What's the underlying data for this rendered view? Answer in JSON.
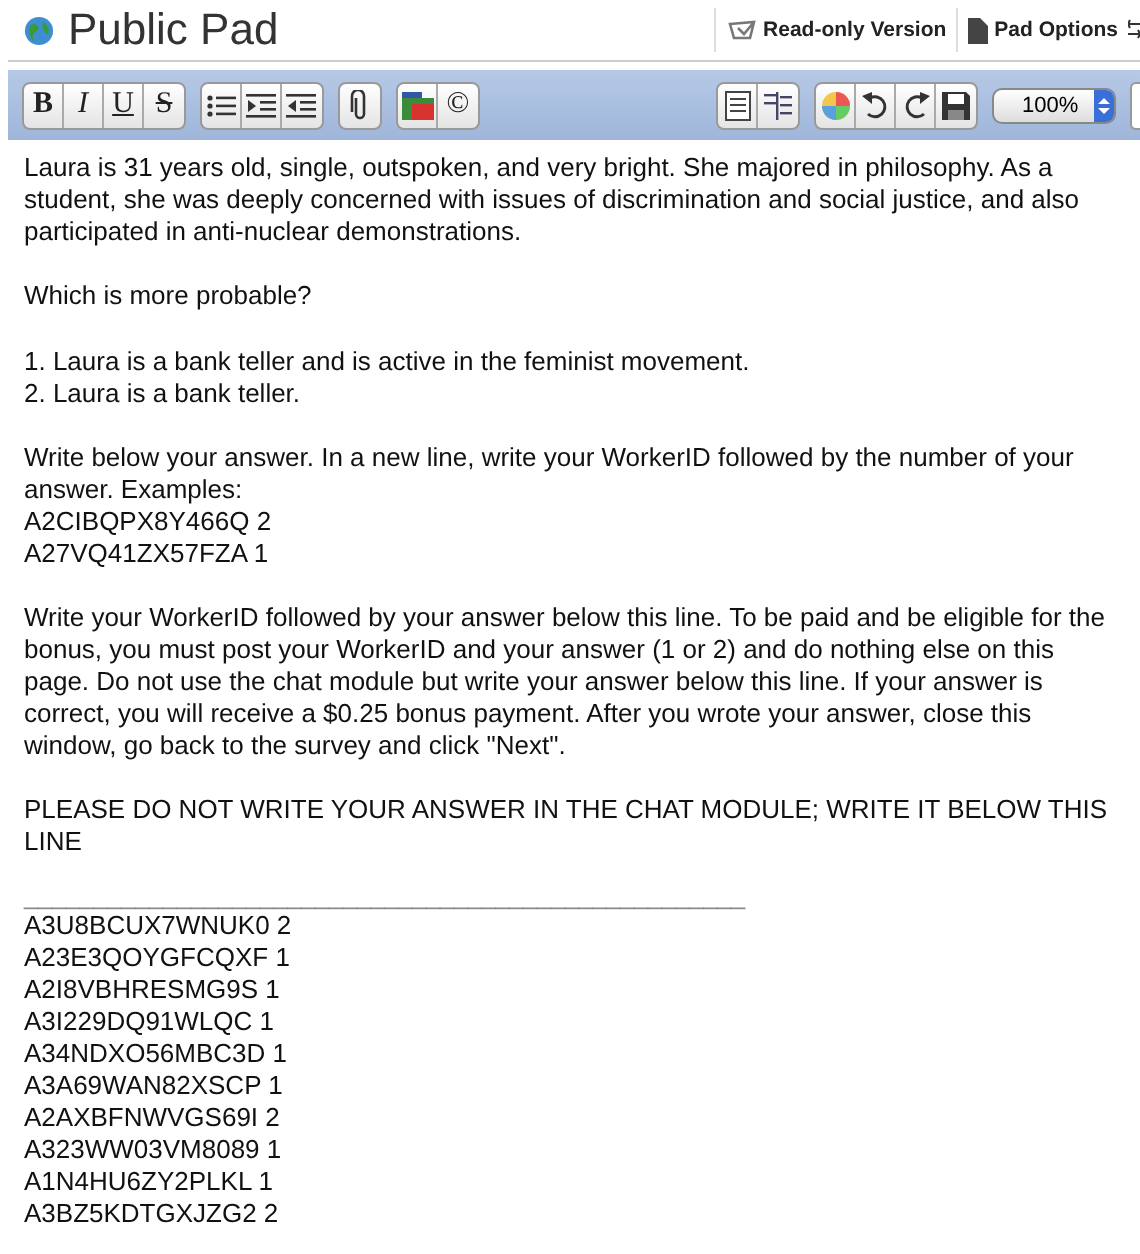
{
  "header": {
    "title": "Public Pad",
    "links": [
      {
        "label": "Read-only Version",
        "kind": "readonly"
      },
      {
        "label": "Pad Options",
        "kind": "options"
      }
    ]
  },
  "toolbar": {
    "left": [
      {
        "buttons": [
          {
            "kind": "bold",
            "label": "B"
          },
          {
            "kind": "italic",
            "label": "I"
          },
          {
            "kind": "underline",
            "label": "U"
          },
          {
            "kind": "strike",
            "label": "S"
          }
        ]
      },
      {
        "buttons": [
          {
            "kind": "bullets"
          },
          {
            "kind": "indent"
          },
          {
            "kind": "outdent"
          }
        ]
      },
      {
        "buttons": [
          {
            "kind": "attach"
          }
        ]
      },
      {
        "buttons": [
          {
            "kind": "flag"
          },
          {
            "kind": "copyright",
            "label": "©"
          }
        ]
      }
    ],
    "right": [
      {
        "buttons": [
          {
            "kind": "doc"
          },
          {
            "kind": "doclines"
          }
        ]
      },
      {
        "buttons": [
          {
            "kind": "colors"
          },
          {
            "kind": "undo"
          },
          {
            "kind": "redo"
          },
          {
            "kind": "save"
          }
        ]
      }
    ],
    "zoom": "100%"
  },
  "document": {
    "blocks": [
      {
        "lines": [
          "Laura is 31 years old, single, outspoken, and very bright. She majored in philosophy. As a student, she was deeply concerned with issues of discrimination and  social justice, and also participated in anti-nuclear demonstrations."
        ]
      },
      {
        "lines": [
          "Which is more probable?"
        ]
      },
      {
        "lines": [
          "1. Laura is a bank teller and is active in the feminist movement.",
          "2. Laura is a bank teller."
        ]
      },
      {
        "lines": [
          "Write below your answer. In a new line, write your WorkerID followed by the number of your answer. Examples:",
          "A2CIBQPX8Y466Q 2",
          "A27VQ41ZX57FZA 1"
        ]
      },
      {
        "lines": [
          "Write your WorkerID followed by your answer below this line. To be paid and be eligible for the bonus, you must post your WorkerID and your answer (1 or 2) and do nothing else on this page. Do not use the chat module but write your answer below this line. If your answer is correct, you will receive a $0.25 bonus payment. After you wrote your answer, close this window, go back to the survey and click \"Next\"."
        ]
      },
      {
        "lines": [
          "PLEASE DO NOT WRITE YOUR ANSWER IN THE CHAT MODULE; WRITE IT BELOW THIS LINE"
        ]
      },
      {
        "kind": "rule",
        "lines": [
          "____________________________________________________"
        ]
      },
      {
        "lines": [
          "A3U8BCUX7WNUK0 2",
          "A23E3QOYGFCQXF 1",
          "A2I8VBHRESMG9S 1",
          "A3I229DQ91WLQC 1",
          "A34NDXO56MBC3D 1",
          "A3A69WAN82XSCP 1",
          "A2AXBFNWVGS69I 2",
          "A323WW03VM8089  1",
          "A1N4HU6ZY2PLKL 1",
          "A3BZ5KDTGXJZG2 2"
        ]
      }
    ]
  }
}
